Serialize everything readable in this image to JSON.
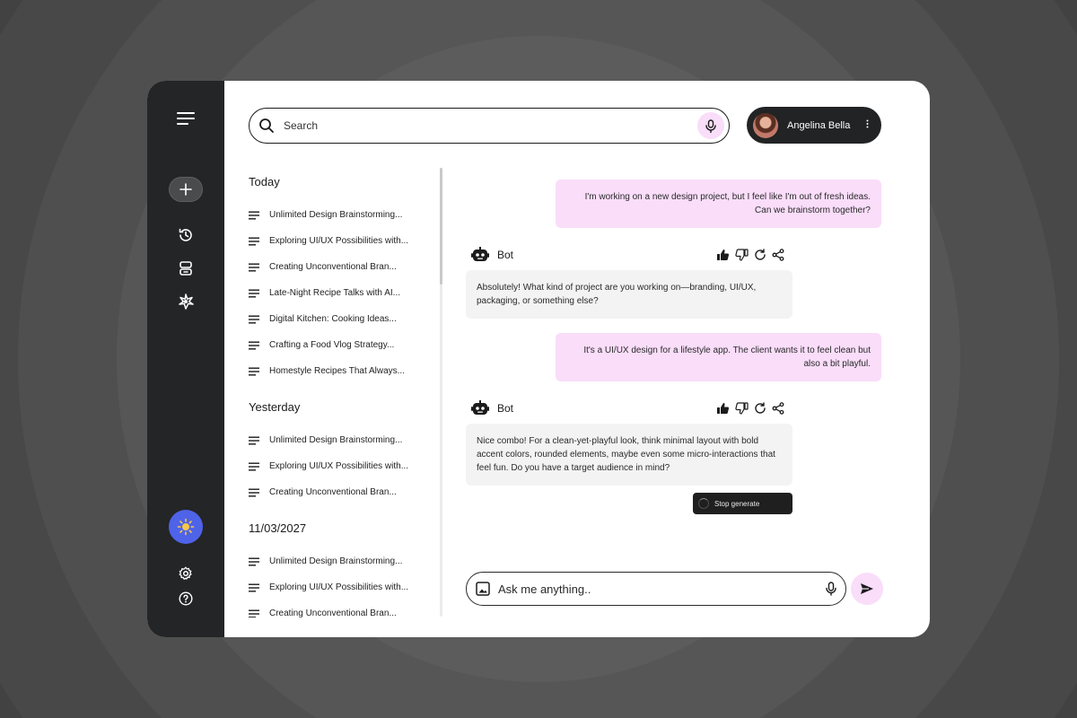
{
  "search": {
    "placeholder": "Search"
  },
  "profile": {
    "name": "Angelina Bella",
    "more_icon": "more-vertical-icon"
  },
  "history": {
    "groups": [
      {
        "title": "Today",
        "items": [
          "Unlimited Design Brainstorming...",
          "Exploring UI/UX Possibilities with...",
          "Creating Unconventional Bran...",
          "Late-Night Recipe Talks with AI...",
          "Digital Kitchen: Cooking Ideas...",
          "Crafting a Food Vlog Strategy...",
          "Homestyle Recipes That Always..."
        ]
      },
      {
        "title": "Yesterday",
        "items": [
          "Unlimited Design Brainstorming...",
          "Exploring UI/UX Possibilities with...",
          "Creating Unconventional Bran..."
        ]
      },
      {
        "title": "11/03/2027",
        "items": [
          "Unlimited Design Brainstorming...",
          "Exploring UI/UX Possibilities with...",
          "Creating Unconventional Bran..."
        ]
      }
    ]
  },
  "chat": {
    "messages": [
      {
        "role": "user",
        "text": "I'm working on a new design project, but I feel like I'm out of fresh ideas. Can we brainstorm together?"
      },
      {
        "role": "bot",
        "name": "Bot",
        "text": "Absolutely! What kind of project are you working on—branding, UI/UX, packaging, or something else?"
      },
      {
        "role": "user",
        "text": "It's a UI/UX design for a lifestyle app. The client wants it to feel clean but also a bit playful."
      },
      {
        "role": "bot",
        "name": "Bot",
        "text": "Nice combo! For a clean-yet-playful look, think minimal layout with bold accent colors, rounded elements, maybe even some micro-interactions that feel fun. Do you have a target audience in mind?"
      }
    ],
    "stop_label": "Stop generate"
  },
  "composer": {
    "placeholder": "Ask me anything.."
  },
  "colors": {
    "accent_pink": "#f9ddf9",
    "sidebar_dark": "#242526",
    "theme_button_blue": "#4f63e8",
    "sun_yellow": "#f7c948"
  }
}
